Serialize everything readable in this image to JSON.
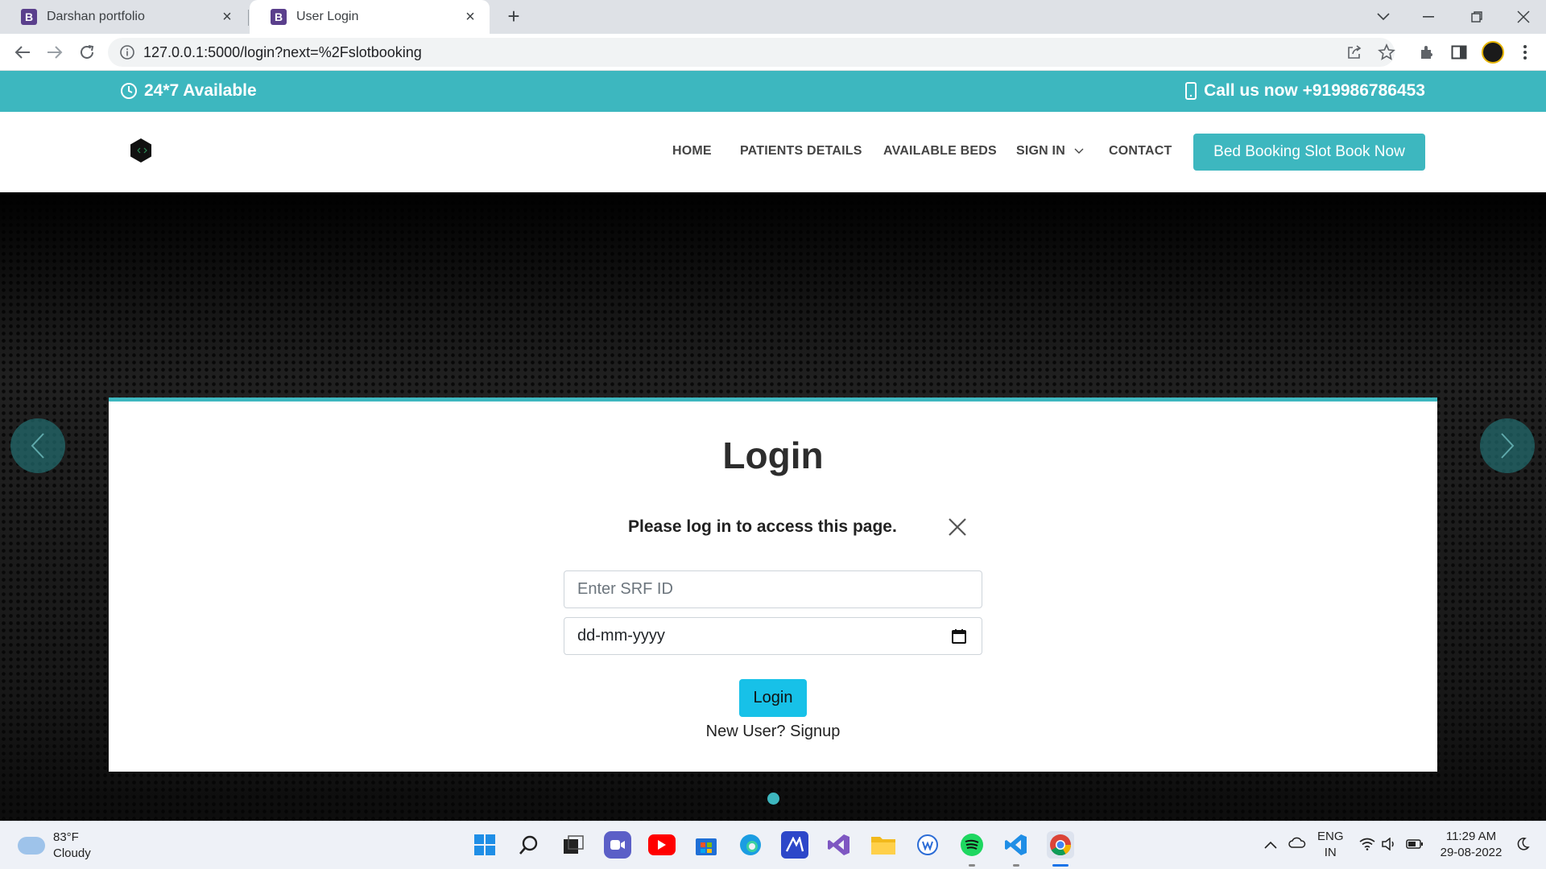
{
  "browser": {
    "tabs": [
      {
        "title": "Darshan portfolio",
        "favicon": "B"
      },
      {
        "title": "User Login",
        "favicon": "B"
      }
    ],
    "url": "127.0.0.1:5000/login?next=%2Fslotbooking"
  },
  "topbar": {
    "availability": "24*7 Available",
    "call": "Call us now +919986786453"
  },
  "nav": {
    "items": [
      "HOME",
      "PATIENTS DETAILS",
      "AVAILABLE BEDS",
      "SIGN IN",
      "CONTACT"
    ],
    "cta": "Bed Booking Slot Book Now"
  },
  "login": {
    "title": "Login",
    "alert": "Please log in to access this page.",
    "srf_placeholder": "Enter  SRF ID",
    "date_placeholder": "dd-mm-yyyy",
    "button": "Login",
    "signup": "New User? Signup"
  },
  "taskbar": {
    "weather_temp": "83°F",
    "weather_desc": "Cloudy",
    "lang": "ENG",
    "region": "IN",
    "time": "11:29 AM",
    "date": "29-08-2022"
  },
  "colors": {
    "accent": "#3db7bf",
    "login_button": "#17c1e8"
  }
}
